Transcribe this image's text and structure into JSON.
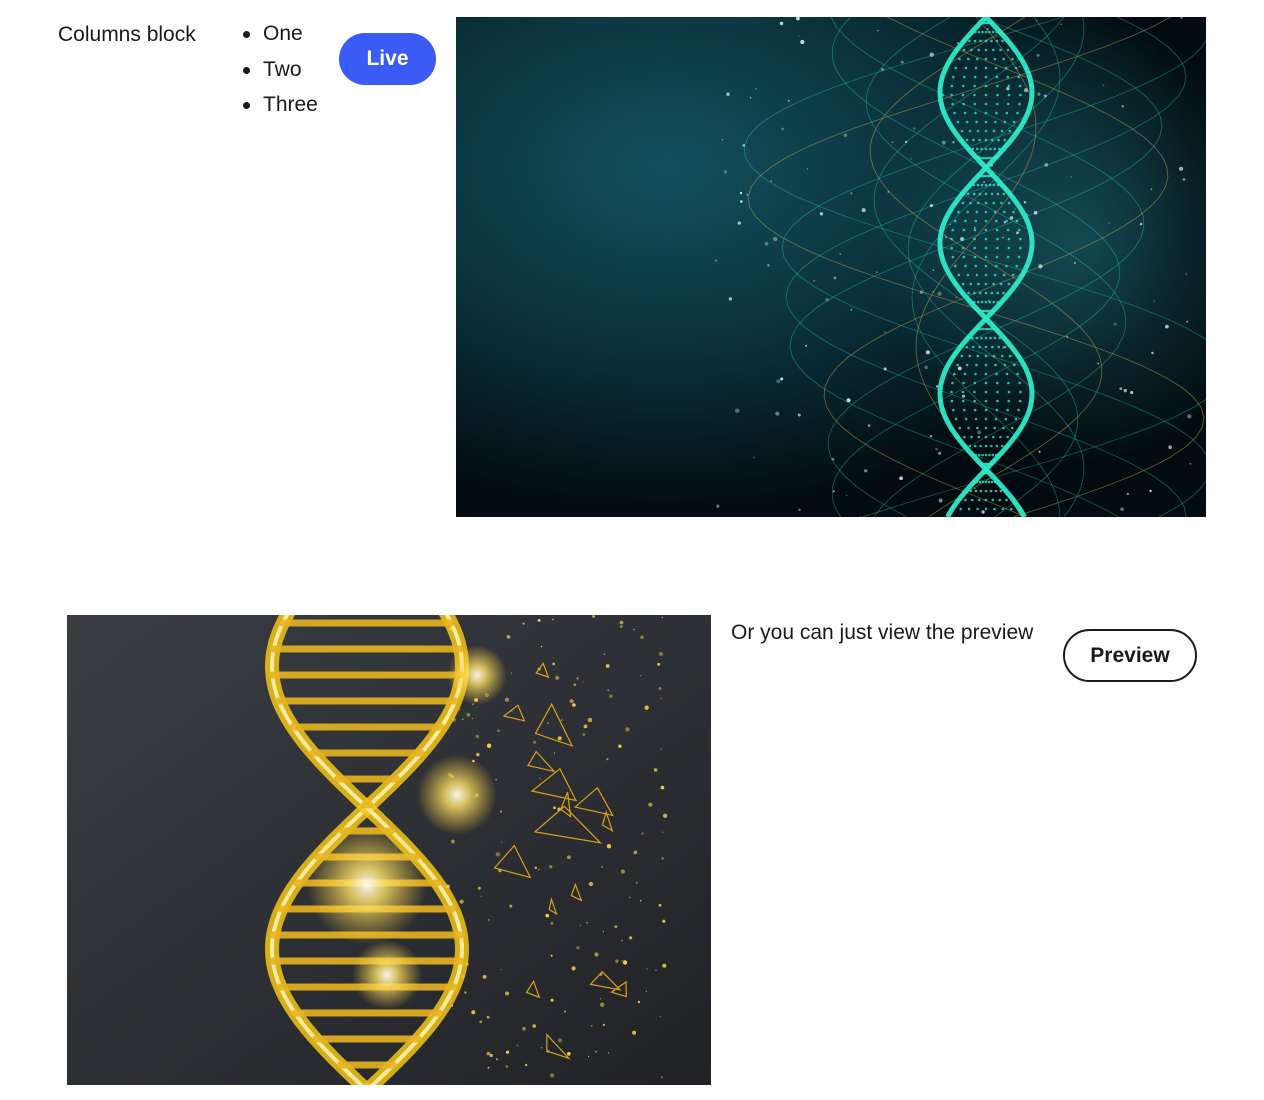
{
  "columns_block": {
    "title": "Columns block",
    "list_items": [
      "One",
      "Two",
      "Three"
    ],
    "live_button_label": "Live",
    "image_top": {
      "alt": "Teal DNA double helix on dark background",
      "icon": "dna-helix-image"
    }
  },
  "preview_section": {
    "text": "Or you can just view the preview",
    "preview_button_label": "Preview",
    "image_bottom": {
      "alt": "Golden DNA double helix on dark background",
      "icon": "dna-helix-image"
    }
  },
  "colors": {
    "primary_button": "#3b5bf5",
    "text": "#1a1a1a",
    "teal_image_bg": "#05181f",
    "teal_accent": "#2ee8c8",
    "gold_image_bg": "#2b2e33",
    "gold_accent": "#f5c518"
  }
}
